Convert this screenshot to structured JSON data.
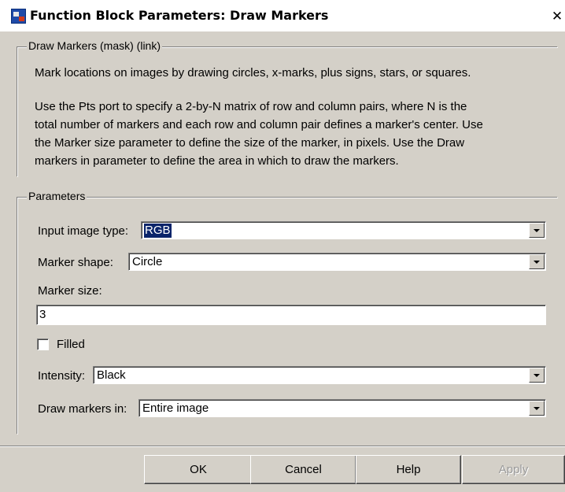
{
  "window": {
    "title": "Function Block Parameters: Draw Markers",
    "close_glyph": "✕"
  },
  "description": {
    "group_title": "Draw Markers (mask) (link)",
    "lines": [
      "Mark locations on images by drawing circles, x-marks, plus signs, stars, or squares.",
      "",
      "Use the Pts port to specify a 2-by-N matrix of row and column pairs, where N is the",
      "total number of markers and each row and column pair defines a marker's center. Use",
      "the Marker size parameter to define the size of the marker, in pixels. Use the Draw",
      "markers in parameter to define the area in which to draw the markers."
    ]
  },
  "parameters": {
    "group_title": "Parameters",
    "input_image_type": {
      "label": "Input image type:",
      "value": "RGB"
    },
    "marker_shape": {
      "label": "Marker shape:",
      "value": "Circle"
    },
    "marker_size": {
      "label": "Marker size:",
      "value": "3"
    },
    "filled": {
      "label": "Filled",
      "checked": false
    },
    "intensity": {
      "label": "Intensity:",
      "value": "Black"
    },
    "draw_markers_in": {
      "label": "Draw markers in:",
      "value": "Entire image"
    }
  },
  "buttons": {
    "ok": "OK",
    "cancel": "Cancel",
    "help": "Help",
    "apply": "Apply"
  },
  "colors": {
    "dialog_bg": "#d4d0c8",
    "selection": "#0a246a"
  }
}
